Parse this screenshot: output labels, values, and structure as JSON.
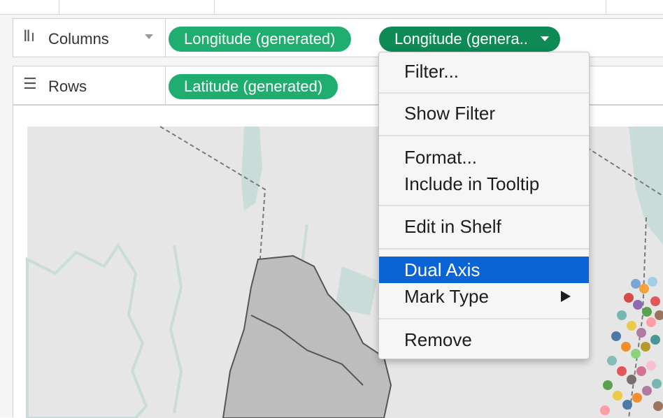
{
  "shelves": {
    "columns": {
      "label": "Columns",
      "icon": "columns-icon",
      "pills": [
        "Longitude (generated)",
        "Longitude (genera.."
      ]
    },
    "rows": {
      "label": "Rows",
      "icon": "rows-icon",
      "pills": [
        "Latitude (generated)"
      ]
    }
  },
  "context_menu": {
    "items": {
      "filter": "Filter...",
      "show_filter": "Show Filter",
      "format": "Format...",
      "include_in_tooltip": "Include in Tooltip",
      "edit_in_shelf": "Edit in Shelf",
      "dual_axis": "Dual Axis",
      "mark_type": "Mark Type",
      "remove": "Remove"
    },
    "highlighted": "Dual Axis"
  },
  "colors": {
    "pill": "#1fae6f",
    "pill_active": "#0d8a56",
    "menu_highlight": "#0a64d6",
    "water": "#c9dcda",
    "land": "#e6e6e6",
    "borough": "#bdbdbd"
  }
}
